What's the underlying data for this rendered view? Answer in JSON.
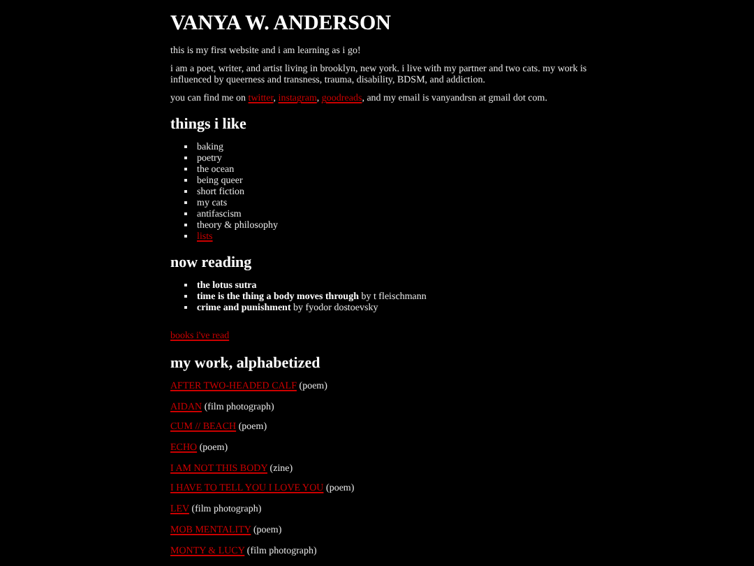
{
  "title": "VANYA W. ANDERSON",
  "intro": "this is my first website and i am learning as i go!",
  "bio": "i am a poet, writer, and artist living in brooklyn, new york. i live with my partner and two cats. my work is influenced by queerness and transness, trauma, disability, BDSM, and addiction.",
  "contact": [
    {
      "kind": "text",
      "text": "you can find me on "
    },
    {
      "kind": "link",
      "text": "twitter"
    },
    {
      "kind": "text",
      "text": ", "
    },
    {
      "kind": "link",
      "text": "instagram"
    },
    {
      "kind": "text",
      "text": ", "
    },
    {
      "kind": "link",
      "text": "goodreads"
    },
    {
      "kind": "text",
      "text": ", and my email is vanyandrsn at gmail dot com."
    }
  ],
  "likes_heading": "things i like",
  "likes": [
    {
      "kind": "text",
      "text": "baking"
    },
    {
      "kind": "text",
      "text": "poetry"
    },
    {
      "kind": "text",
      "text": "the ocean"
    },
    {
      "kind": "text",
      "text": "being queer"
    },
    {
      "kind": "text",
      "text": "short fiction"
    },
    {
      "kind": "text",
      "text": "my cats"
    },
    {
      "kind": "text",
      "text": "antifascism"
    },
    {
      "kind": "text",
      "text": "theory & philosophy"
    },
    {
      "kind": "link",
      "text": "lists"
    }
  ],
  "reading_heading": "now reading",
  "reading": [
    {
      "title": "the lotus sutra"
    },
    {
      "title": "time is the thing a body moves through",
      "byline": "by t fleischmann"
    },
    {
      "title": "crime and punishment",
      "byline": "by fyodor dostoevsky"
    }
  ],
  "books_link": "books i've read",
  "work_heading": "my work, alphabetized",
  "works": [
    {
      "title": "AFTER TWO-HEADED CALF",
      "type": "(poem)"
    },
    {
      "title": "AIDAN",
      "type": "(film photograph)"
    },
    {
      "title": "CUM // BEACH",
      "type": "(poem)"
    },
    {
      "title": "ECHO",
      "type": "(poem)"
    },
    {
      "title": "I AM NOT THIS BODY",
      "type": "(zine)"
    },
    {
      "title": "I HAVE TO TELL YOU I LOVE YOU",
      "type": "(poem)"
    },
    {
      "title": "LEV",
      "type": "(film photograph)"
    },
    {
      "title": "MOB MENTALITY",
      "type": "(poem)"
    },
    {
      "title": "MONTY & LUCY",
      "type": "(film photograph)"
    }
  ]
}
